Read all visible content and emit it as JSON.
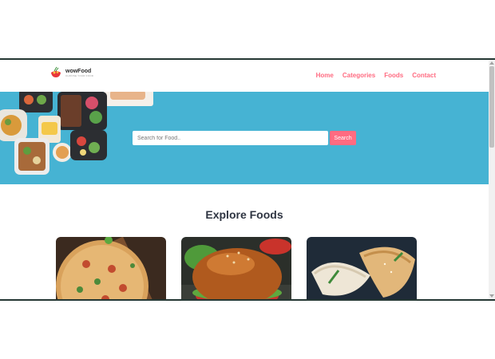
{
  "navbar": {
    "logo_name": "wowFood",
    "logo_tagline": "CHOOSE YOUR FOOD",
    "links": [
      "Home",
      "Categories",
      "Foods",
      "Contact"
    ]
  },
  "hero": {
    "search_placeholder": "Search for Food..",
    "search_button": "Search"
  },
  "explore": {
    "title": "Explore Foods",
    "cards": [
      {
        "image": "pizza-image"
      },
      {
        "image": "burger-image"
      },
      {
        "image": "dumplings-image"
      }
    ]
  },
  "colors": {
    "accent": "#ff6b81",
    "hero_bg": "#46b3d3",
    "title": "#2f3542"
  }
}
